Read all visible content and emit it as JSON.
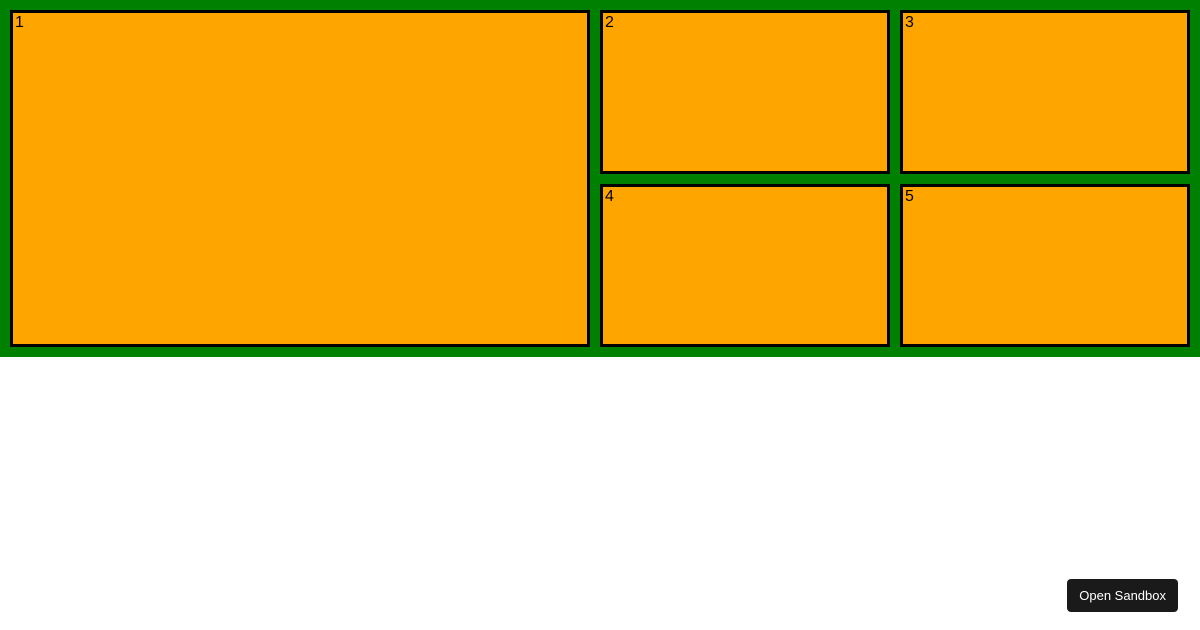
{
  "grid": {
    "items": [
      {
        "label": "1"
      },
      {
        "label": "2"
      },
      {
        "label": "3"
      },
      {
        "label": "4"
      },
      {
        "label": "5"
      }
    ]
  },
  "colors": {
    "container_bg": "green",
    "item_bg": "orange",
    "item_border": "black"
  },
  "button": {
    "open_sandbox_label": "Open Sandbox"
  }
}
